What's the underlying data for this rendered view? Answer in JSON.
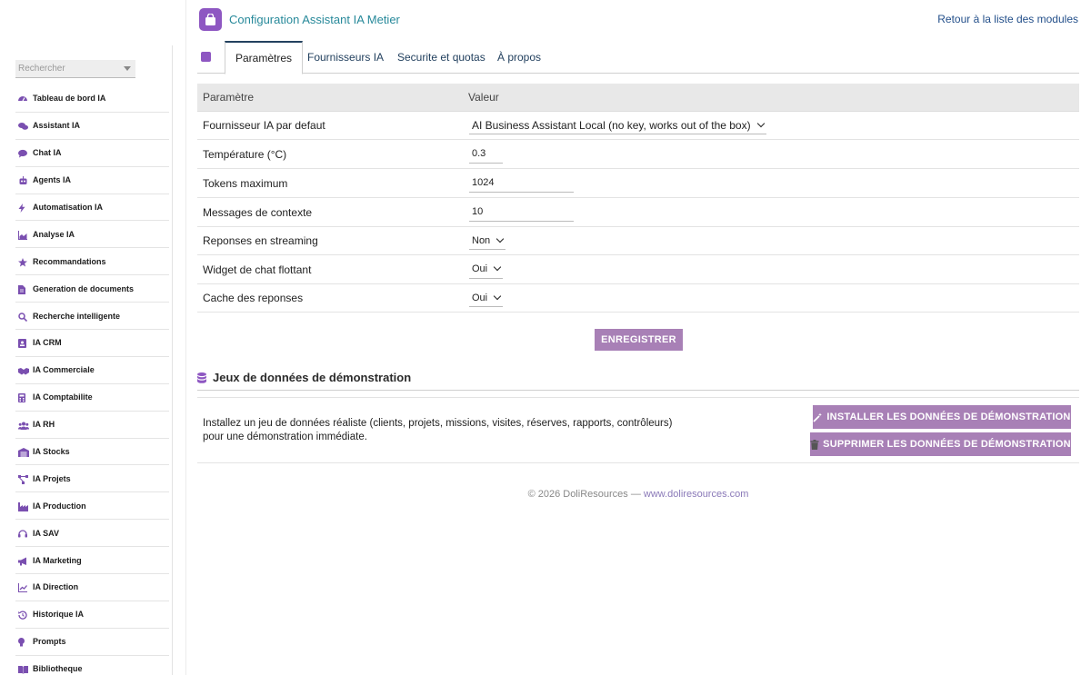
{
  "app": {
    "title": "Configuration Assistant IA Metier",
    "back_link": "Retour à la liste des modules",
    "accent_color": "#8e57c2",
    "button_color": "#a880b6"
  },
  "sidebar": {
    "search_placeholder": "Rechercher",
    "items": [
      {
        "label": "Tableau de bord IA",
        "icon": "dashboard-icon"
      },
      {
        "label": "Assistant IA",
        "icon": "chat-bubbles-icon"
      },
      {
        "label": "Chat IA",
        "icon": "chat-icon"
      },
      {
        "label": "Agents IA",
        "icon": "robot-icon"
      },
      {
        "label": "Automatisation IA",
        "icon": "bolt-icon"
      },
      {
        "label": "Analyse IA",
        "icon": "chart-area-icon"
      },
      {
        "label": "Recommandations",
        "icon": "star-icon"
      },
      {
        "label": "Generation de documents",
        "icon": "document-icon"
      },
      {
        "label": "Recherche intelligente",
        "icon": "search-icon"
      },
      {
        "label": "IA CRM",
        "icon": "contact-card-icon"
      },
      {
        "label": "IA Commerciale",
        "icon": "handshake-icon"
      },
      {
        "label": "IA Comptabilite",
        "icon": "calculator-icon"
      },
      {
        "label": "IA RH",
        "icon": "users-icon"
      },
      {
        "label": "IA Stocks",
        "icon": "warehouse-icon"
      },
      {
        "label": "IA Projets",
        "icon": "project-diagram-icon"
      },
      {
        "label": "IA Production",
        "icon": "industry-icon"
      },
      {
        "label": "IA SAV",
        "icon": "headset-icon"
      },
      {
        "label": "IA Marketing",
        "icon": "bullhorn-icon"
      },
      {
        "label": "IA Direction",
        "icon": "chart-line-icon"
      },
      {
        "label": "Historique IA",
        "icon": "history-icon"
      },
      {
        "label": "Prompts",
        "icon": "lightbulb-icon"
      },
      {
        "label": "Bibliotheque",
        "icon": "book-icon"
      }
    ]
  },
  "tabs": [
    {
      "label": "Paramètres",
      "active": true
    },
    {
      "label": "Fournisseurs IA",
      "active": false
    },
    {
      "label": "Securite et quotas",
      "active": false
    },
    {
      "label": "À propos",
      "active": false
    }
  ],
  "table": {
    "header": {
      "param": "Paramètre",
      "value": "Valeur"
    },
    "rows": [
      {
        "label": "Fournisseur IA par defaut",
        "type": "select",
        "value": "AI Business Assistant Local (no key, works out of the box)"
      },
      {
        "label": "Température (°C)",
        "type": "input",
        "value": "0.3"
      },
      {
        "label": "Tokens maximum",
        "type": "input",
        "value": "1024"
      },
      {
        "label": "Messages de contexte",
        "type": "input",
        "value": "10"
      },
      {
        "label": "Reponses en streaming",
        "type": "select",
        "value": "Non"
      },
      {
        "label": "Widget de chat flottant",
        "type": "select",
        "value": "Oui"
      },
      {
        "label": "Cache des reponses",
        "type": "select",
        "value": "Oui"
      }
    ]
  },
  "save_label": "ENREGISTRER",
  "demo": {
    "title": "Jeux de données de démonstration",
    "description_line1": "Installez un jeu de données réaliste (clients, projets, missions, visites, réserves, rapports, contrôleurs)",
    "description_line2": "pour une démonstration immédiate.",
    "install_label": "INSTALLER LES DONNÉES DE DÉMONSTRATION",
    "delete_label": "SUPPRIMER LES DONNÉES DE DÉMONSTRATION"
  },
  "footer": {
    "copyright": "© 2026 DoliResources — ",
    "link": "www.doliresources.com"
  }
}
